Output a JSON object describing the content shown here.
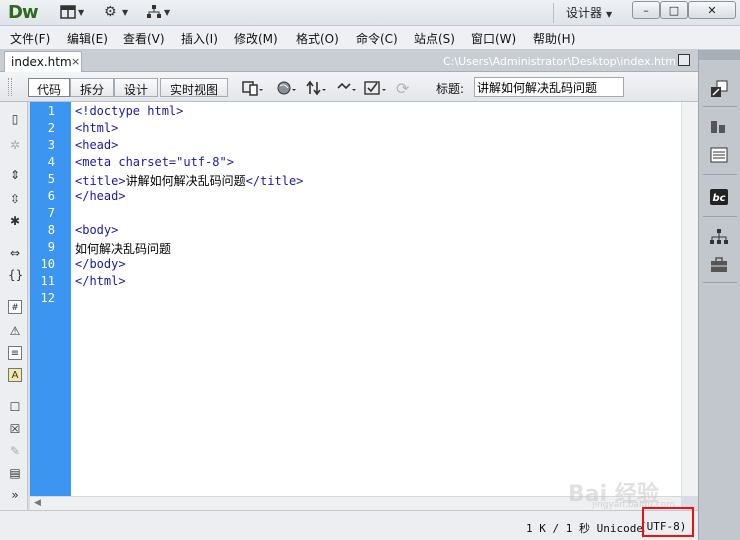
{
  "app": {
    "logo": "Dw",
    "workspace_label": "设计器",
    "window_buttons": [
      "–",
      "□",
      "✕"
    ]
  },
  "menu": [
    "文件(F)",
    "编辑(E)",
    "查看(V)",
    "插入(I)",
    "修改(M)",
    "格式(O)",
    "命令(C)",
    "站点(S)",
    "窗口(W)",
    "帮助(H)"
  ],
  "document": {
    "tab_name": "index.htm",
    "tab_close": "×",
    "file_path": "C:\\Users\\Administrator\\Desktop\\index.htm"
  },
  "toolbar": {
    "views": [
      "代码",
      "拆分",
      "设计",
      "实时视图"
    ],
    "active_view": "代码",
    "title_label": "标题:",
    "title_value": "讲解如何解决乱码问题"
  },
  "editor": {
    "lines": [
      {
        "n": "1",
        "tag": "<!doctype html>",
        "text": ""
      },
      {
        "n": "2",
        "tag": "<html>",
        "text": ""
      },
      {
        "n": "3",
        "tag": "<head>",
        "text": ""
      },
      {
        "n": "4",
        "tag": "<meta charset=\"utf-8\">",
        "text": ""
      },
      {
        "n": "5",
        "tag": "<title>",
        "text": "讲解如何解决乱码问题",
        "tag_end": "</title>"
      },
      {
        "n": "6",
        "tag": "</head>",
        "text": ""
      },
      {
        "n": "7",
        "tag": "",
        "text": ""
      },
      {
        "n": "8",
        "tag": "<body>",
        "text": ""
      },
      {
        "n": "9",
        "tag": "",
        "text": "如何解决乱码问题"
      },
      {
        "n": "10",
        "tag": "</body>",
        "text": ""
      },
      {
        "n": "11",
        "tag": "</html>",
        "text": ""
      },
      {
        "n": "12",
        "tag": "",
        "text": ""
      }
    ]
  },
  "status": {
    "size": "1 K / 1 秒",
    "encoding_name": "Unicode",
    "encoding": "(UTF-8)"
  },
  "watermark": {
    "text": "Bai 经验",
    "sub": "jingyan.baidu.com"
  }
}
